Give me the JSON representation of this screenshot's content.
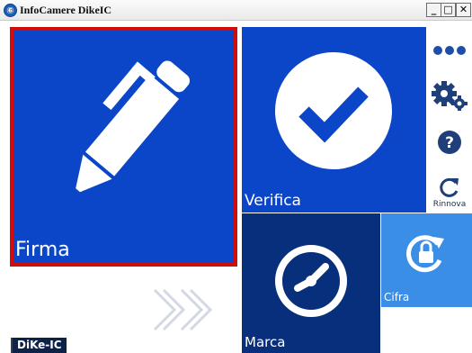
{
  "window": {
    "title": "InfoCamere DikeIC",
    "app_icon_glyph": "⑥",
    "controls": {
      "minimize": "_",
      "maximize": "□",
      "close": "✕"
    }
  },
  "tiles": {
    "firma": {
      "label": "Firma",
      "icon": "pen-icon",
      "selected": true,
      "color": "#0a46c7",
      "border_color": "#d00c0c"
    },
    "verifica": {
      "label": "Verifica",
      "icon": "checkmark-icon",
      "color": "#0a46c7"
    },
    "marca": {
      "label": "Marca",
      "icon": "clock-icon",
      "color": "#082f7c"
    },
    "cifra": {
      "label": "Cifra",
      "icon": "lock-refresh-icon",
      "color": "#3b8ee6"
    }
  },
  "side_panel": {
    "more": {
      "icon": "more-dots-icon"
    },
    "settings": {
      "icon": "gears-icon"
    },
    "help": {
      "icon": "help-icon",
      "glyph": "?"
    },
    "renew": {
      "icon": "refresh-icon",
      "label": "Rinnova"
    }
  },
  "footer": {
    "app_name": "DiKe-IC",
    "next_icon": "double-chevron-right-icon"
  },
  "colors": {
    "accent": "#0a46c7",
    "dark": "#082f7c",
    "light": "#3b8ee6",
    "panel_icon": "#1e4fa8"
  }
}
